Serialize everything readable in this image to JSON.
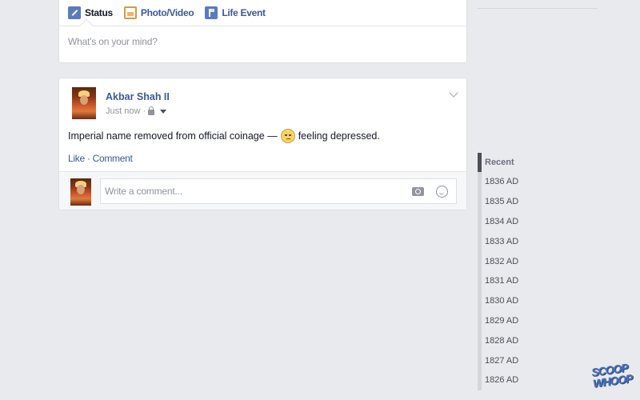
{
  "composer": {
    "tabs": [
      {
        "label": "Status",
        "icon": "pencil-icon"
      },
      {
        "label": "Photo/Video",
        "icon": "photo-icon"
      },
      {
        "label": "Life Event",
        "icon": "flag-icon"
      }
    ],
    "placeholder": "What's on your mind?"
  },
  "post": {
    "author": "Akbar Shah II",
    "time": "Just now ·",
    "text_before": "Imperial name removed from official coinage —",
    "feeling": "feeling depressed.",
    "actions": "Like · Comment",
    "comment_placeholder": "Write a comment..."
  },
  "timeline": {
    "items": [
      "Recent",
      "1836 AD",
      "1835 AD",
      "1834 AD",
      "1833 AD",
      "1832 AD",
      "1831 AD",
      "1830 AD",
      "1829 AD",
      "1828 AD",
      "1827 AD",
      "1826 AD"
    ]
  },
  "watermark": "SCOOP WHOOP",
  "colors": {
    "link": "#3b5998",
    "background": "#e9eaed"
  }
}
